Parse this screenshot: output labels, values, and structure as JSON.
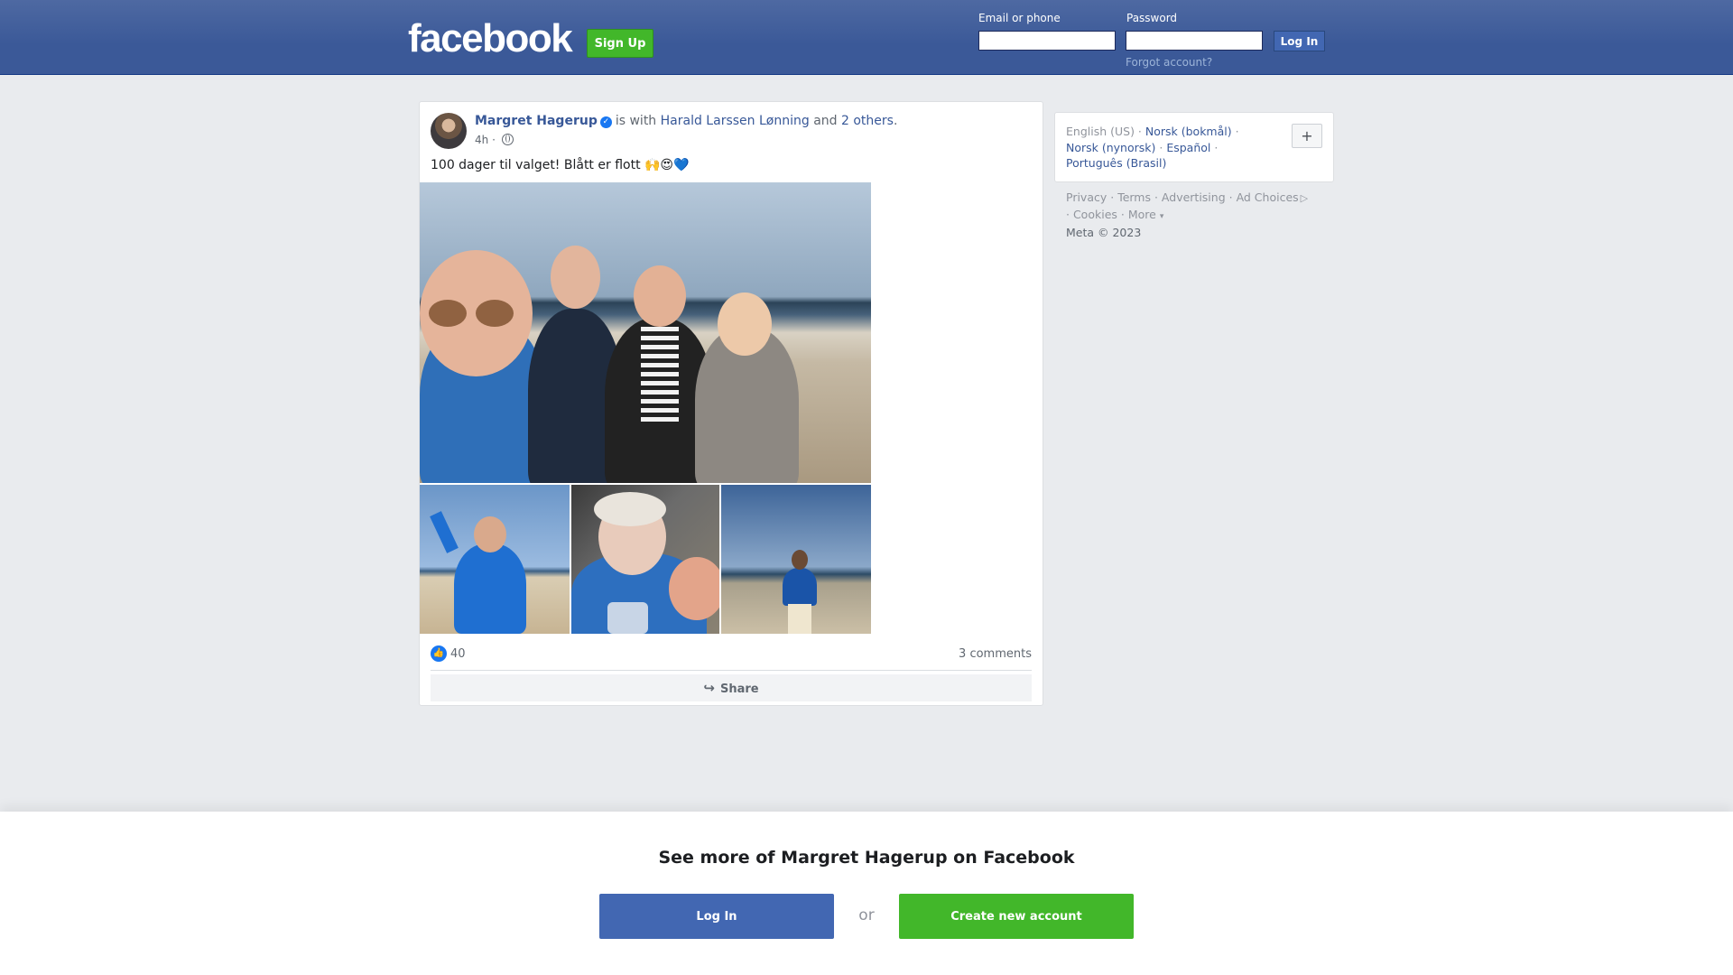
{
  "topbar": {
    "logo": "facebook",
    "signup_label": "Sign Up",
    "email_label": "Email or phone",
    "email_value": "",
    "password_label": "Password",
    "password_value": "",
    "login_label": "Log In",
    "forgot_link": "Forgot account?",
    "brand_color": "#3b5998",
    "signup_color": "#42b72a"
  },
  "post": {
    "author": "Margret Hagerup",
    "verified": true,
    "with_text": "is with",
    "tagged_person": "Harald Larssen Lønning",
    "and_text": "and",
    "others_link": "2 others",
    "period": ".",
    "time": "4h",
    "separator": "·",
    "privacy_icon": "globe-icon",
    "text": "100 dager til valget! Blått er flott 🙌😍💙",
    "photos": [
      {
        "name": "photo-main",
        "description_icon": "photo"
      },
      {
        "name": "photo-2",
        "description_icon": "photo"
      },
      {
        "name": "photo-3",
        "description_icon": "photo"
      },
      {
        "name": "photo-4",
        "description_icon": "photo"
      }
    ],
    "reaction_icon": "like-icon",
    "reaction_count": "40",
    "comments": "3 comments",
    "share_label": "Share"
  },
  "languages": {
    "current": "English (US)",
    "options": [
      "Norsk (bokmål)",
      "Norsk (nynorsk)",
      "Español",
      "Português (Brasil)"
    ],
    "more_label": "+"
  },
  "footer": {
    "links": [
      "Privacy",
      "Terms",
      "Advertising",
      "Ad Choices",
      "Cookies",
      "More"
    ],
    "more_arrow": "▾",
    "copyright": "Meta © 2023"
  },
  "banner": {
    "title": "See more of Margret Hagerup on Facebook",
    "login_label": "Log In",
    "or_text": "or",
    "create_label": "Create new account"
  }
}
